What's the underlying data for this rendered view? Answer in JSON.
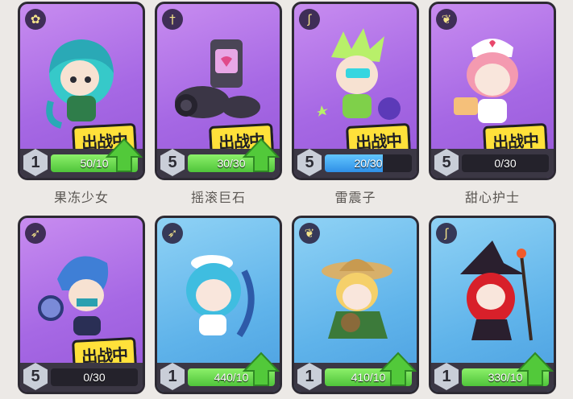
{
  "row1": [
    {
      "name": "果冻少女",
      "level": "1",
      "progress": "50/10",
      "fill": 1.0,
      "fill_color": "green",
      "bg": "purple",
      "icon": "potion-icon",
      "icon_glyph": "✿",
      "deployed": true,
      "upgrade": true
    },
    {
      "name": "摇滚巨石",
      "level": "5",
      "progress": "30/30",
      "fill": 1.0,
      "fill_color": "green",
      "bg": "purple",
      "icon": "sword-icon",
      "icon_glyph": "†",
      "deployed": true,
      "upgrade": true
    },
    {
      "name": "雷震子",
      "level": "5",
      "progress": "20/30",
      "fill": 0.67,
      "fill_color": "blue",
      "bg": "purple",
      "icon": "staff-icon",
      "icon_glyph": "ʃ",
      "deployed": true,
      "upgrade": false
    },
    {
      "name": "甜心护士",
      "level": "5",
      "progress": "0/30",
      "fill": 0.0,
      "fill_color": "blue",
      "bg": "purple",
      "icon": "wings-icon",
      "icon_glyph": "❦",
      "deployed": true,
      "upgrade": false
    }
  ],
  "row2": [
    {
      "level": "5",
      "progress": "0/30",
      "fill": 0.0,
      "fill_color": "blue",
      "bg": "purple",
      "icon": "bow-icon",
      "icon_glyph": "➶",
      "deployed": true,
      "upgrade": false
    },
    {
      "level": "1",
      "progress": "440/10",
      "fill": 1.0,
      "fill_color": "green",
      "bg": "blue",
      "icon": "bow-icon",
      "icon_glyph": "➶",
      "deployed": false,
      "upgrade": true
    },
    {
      "level": "1",
      "progress": "410/10",
      "fill": 1.0,
      "fill_color": "green",
      "bg": "blue",
      "icon": "wings-icon",
      "icon_glyph": "❦",
      "deployed": false,
      "upgrade": true
    },
    {
      "level": "1",
      "progress": "330/10",
      "fill": 1.0,
      "fill_color": "green",
      "bg": "blue",
      "icon": "staff-icon",
      "icon_glyph": "ʃ",
      "deployed": false,
      "upgrade": true
    }
  ],
  "badge_label": "出战中",
  "colors": {
    "purple_card": "#a668e4",
    "blue_card": "#5fb3ea",
    "green_fill": "#4fc43a",
    "blue_fill": "#2f8fe6",
    "badge": "#ffe13a",
    "arrow": "#52c93a"
  }
}
